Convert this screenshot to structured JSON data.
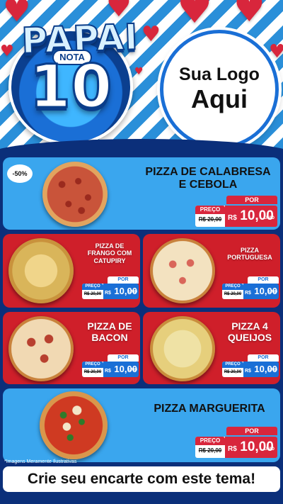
{
  "header": {
    "title_word": "PAPAI",
    "badge_word": "NOTA",
    "badge_number": "10",
    "logo_line1": "Sua Logo",
    "logo_line2": "Aqui"
  },
  "labels": {
    "por": "POR",
    "preco": "PREÇO",
    "old_price": "R$ 20,00",
    "currency": "R$",
    "unid": "UNID"
  },
  "products": [
    {
      "name_line1": "PIZZA DE CALABRESA",
      "name_line2": "E CEBOLA",
      "discount": "-50%",
      "price": "10,00"
    },
    {
      "name_line1": "PIZZA DE",
      "name_line2": "FRANGO COM",
      "name_line3": "CATUPIRY",
      "price": "10,00"
    },
    {
      "name_line1": "PIZZA",
      "name_line2": "PORTUGUESA",
      "price": "10,00"
    },
    {
      "name_line1": "PIZZA DE",
      "name_line2": "BACON",
      "price": "10,00"
    },
    {
      "name_line1": "PIZZA 4",
      "name_line2": "QUEIJOS",
      "price": "10,00"
    },
    {
      "name_line1": "PIZZA MARGUERITA",
      "price": "10,00"
    }
  ],
  "footer": {
    "disclaimer": "*Imagens Meramente Ilustrativas",
    "cta": "Crie seu encarte com este tema!"
  },
  "colors": {
    "navy": "#0b2f7a",
    "blue_card": "#3aa6ee",
    "red_card": "#cf1f2a",
    "tag_red": "#d8263c",
    "tag_blue": "#1a6fd6"
  }
}
